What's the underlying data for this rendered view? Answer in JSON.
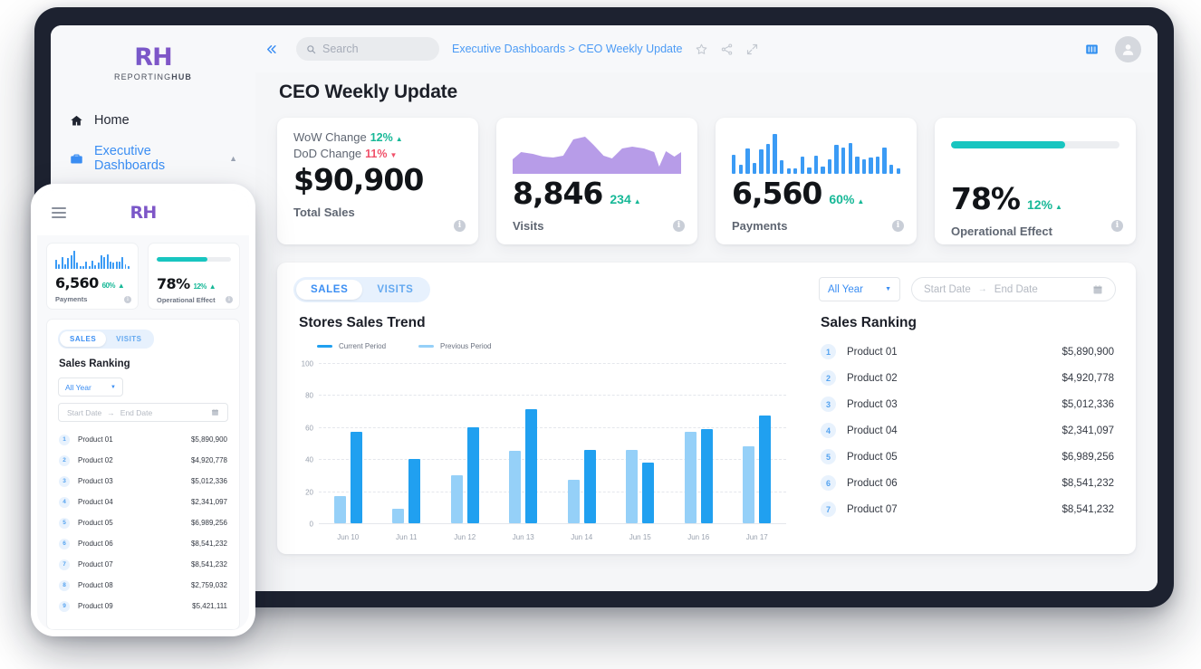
{
  "brand": {
    "logo": "RH",
    "name_light": "REPORTING",
    "name_bold": "HUB"
  },
  "sidebar": {
    "items": [
      {
        "label": "Home",
        "icon": "home-icon"
      },
      {
        "label": "Executive Dashboards",
        "icon": "briefcase-icon"
      }
    ],
    "sub_item": "CEO Weekly Update"
  },
  "topbar": {
    "collapse_icon": "chevron-double-left-icon",
    "search_placeholder": "Search",
    "search_value": "",
    "breadcrumb": "Executive Dashboards > CEO Weekly Update",
    "icons": [
      "star-icon",
      "share-icon",
      "expand-icon"
    ],
    "layout_icon": "columns-layout-icon",
    "avatar_icon": "user-avatar-icon"
  },
  "page": {
    "title": "CEO Weekly Update"
  },
  "kpis": [
    {
      "type": "changes",
      "wow_label": "WoW Change",
      "wow_value": "12%",
      "wow_dir": "up",
      "dod_label": "DoD Change",
      "dod_value": "11%",
      "dod_dir": "down",
      "value": "$90,900",
      "label": "Total Sales",
      "info": "i"
    },
    {
      "type": "area",
      "value": "8,846",
      "delta": "234",
      "delta_dir": "up",
      "label": "Visits",
      "info": "i",
      "color": "#b79ce8"
    },
    {
      "type": "bars",
      "value": "6,560",
      "delta": "60%",
      "delta_dir": "up",
      "label": "Payments",
      "info": "i",
      "color": "#3b9bf5",
      "bars": [
        46,
        22,
        60,
        25,
        58,
        72,
        95,
        33,
        12,
        14,
        40,
        16,
        44,
        18,
        34,
        70,
        63,
        74,
        40,
        34,
        38,
        40,
        62,
        22,
        12
      ]
    },
    {
      "type": "progress",
      "value": "78%",
      "delta": "12%",
      "delta_dir": "up",
      "label": "Operational Effect",
      "info": "i",
      "progress": 68,
      "color": "#18c5c0"
    }
  ],
  "panel": {
    "tabs": [
      {
        "label": "SALES",
        "active": true
      },
      {
        "label": "VISITS",
        "active": false
      }
    ],
    "ranking_title": "Sales Ranking",
    "filter": {
      "select_value": "All Year",
      "caret": "chevron-down-icon"
    },
    "date_range": {
      "start_placeholder": "Start Date",
      "separator": "→",
      "end_placeholder": "End Date",
      "calendar_icon": "calendar-icon"
    },
    "ranking": [
      {
        "rank": "1",
        "name": "Product 01",
        "value": "$5,890,900"
      },
      {
        "rank": "2",
        "name": "Product 02",
        "value": "$4,920,778"
      },
      {
        "rank": "3",
        "name": "Product 03",
        "value": "$5,012,336"
      },
      {
        "rank": "4",
        "name": "Product 04",
        "value": "$2,341,097"
      },
      {
        "rank": "5",
        "name": "Product 05",
        "value": "$6,989,256"
      },
      {
        "rank": "6",
        "name": "Product 06",
        "value": "$8,541,232"
      },
      {
        "rank": "7",
        "name": "Product 07",
        "value": "$8,541,232"
      }
    ]
  },
  "chart_data": {
    "type": "bar",
    "title": "Stores Sales Trend",
    "xlabel": "",
    "ylabel": "",
    "ylim": [
      0,
      100
    ],
    "yticks": [
      0,
      20,
      40,
      60,
      80,
      100
    ],
    "grid": true,
    "legend_position": "top-left",
    "categories": [
      "Jun 10",
      "Jun 11",
      "Jun 12",
      "Jun 13",
      "Jun 14",
      "Jun 15",
      "Jun 16",
      "Jun 17"
    ],
    "series": [
      {
        "name": "Previous Period",
        "color": "#95d0f8",
        "values": [
          17,
          9,
          30,
          45,
          27,
          46,
          57,
          48
        ]
      },
      {
        "name": "Current Period",
        "color": "#20a0f0",
        "values": [
          57,
          40,
          60,
          71,
          46,
          38,
          59,
          67
        ]
      }
    ]
  },
  "mobile": {
    "hamburger_icon": "hamburger-menu-icon",
    "logo": "RH",
    "kpis": [
      {
        "type": "bars",
        "value": "6,560",
        "delta": "60%",
        "delta_dir": "up",
        "label": "Payments",
        "info": "i",
        "bars": [
          46,
          22,
          60,
          25,
          58,
          72,
          95,
          33,
          12,
          14,
          40,
          16,
          44,
          18,
          34,
          70,
          63,
          74,
          40,
          34,
          38,
          40,
          62,
          22,
          12
        ]
      },
      {
        "type": "progress",
        "value": "78%",
        "delta": "12%",
        "delta_dir": "up",
        "label": "Operational Effect",
        "info": "i",
        "progress": 68
      }
    ],
    "tabs": [
      {
        "label": "SALES",
        "active": true
      },
      {
        "label": "VISITS",
        "active": false
      }
    ],
    "ranking_title": "Sales Ranking",
    "filter": {
      "select_value": "All Year"
    },
    "date_range": {
      "start_placeholder": "Start Date",
      "separator": "→",
      "end_placeholder": "End Date",
      "calendar_icon": "calendar-icon"
    },
    "ranking": [
      {
        "rank": "1",
        "name": "Product 01",
        "value": "$5,890,900"
      },
      {
        "rank": "2",
        "name": "Product 02",
        "value": "$4,920,778"
      },
      {
        "rank": "3",
        "name": "Product 03",
        "value": "$5,012,336"
      },
      {
        "rank": "4",
        "name": "Product 04",
        "value": "$2,341,097"
      },
      {
        "rank": "5",
        "name": "Product 05",
        "value": "$6,989,256"
      },
      {
        "rank": "6",
        "name": "Product 06",
        "value": "$8,541,232"
      },
      {
        "rank": "7",
        "name": "Product 07",
        "value": "$8,541,232"
      },
      {
        "rank": "8",
        "name": "Product 08",
        "value": "$2,759,032"
      },
      {
        "rank": "9",
        "name": "Product 09",
        "value": "$5,421,111"
      }
    ]
  },
  "colors": {
    "accent_blue": "#3b8ef3",
    "chart_current": "#20a0f0",
    "chart_previous": "#95d0f8",
    "up_green": "#17b897",
    "down_red": "#f0516a",
    "teal": "#18c5c0",
    "purple": "#b79ce8"
  }
}
